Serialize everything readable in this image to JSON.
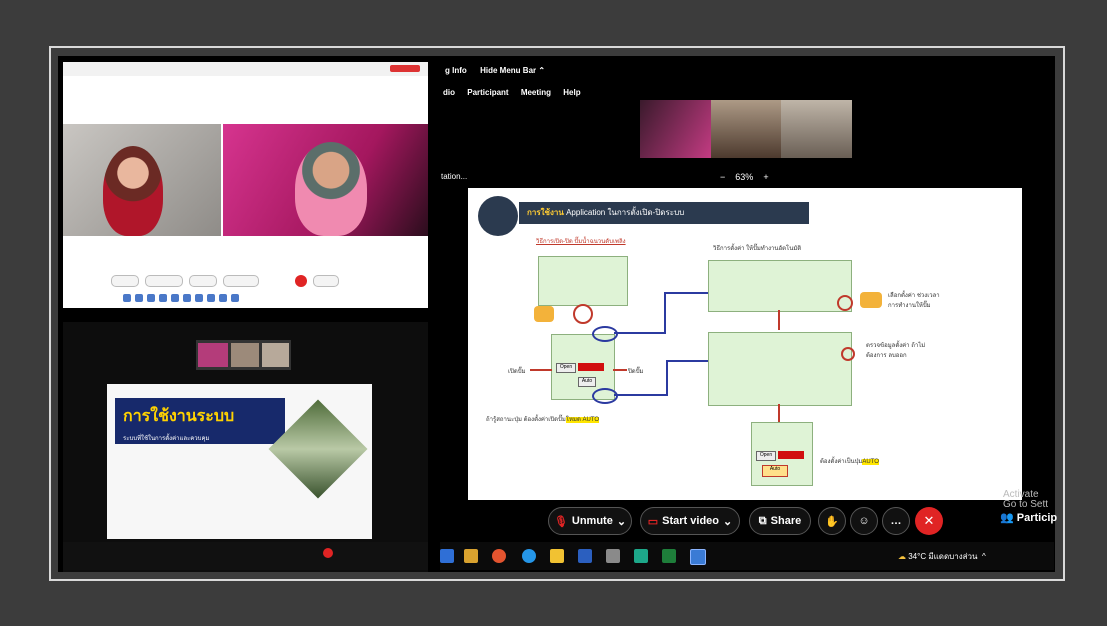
{
  "top_right_panel": {
    "menu_left": "g Info",
    "menu_hide": "Hide Menu Bar",
    "menu_items": [
      "dio",
      "Participant",
      "Meeting",
      "Help"
    ],
    "sharing_label": "tation...",
    "zoom_minus": "−",
    "zoom_value": "63%",
    "zoom_plus": "+"
  },
  "slide": {
    "header_bold": "การใช้งาน",
    "header_text": "Application ในการตั้งเปิด-ปิดระบบ",
    "step1_label": "วิธีการเปิด-ปิด ปั๊มน้ำฉนวนดับเพลิง",
    "step2_label": "วิธีการตั้งค่า ให้ปั๊มทำงานอัตโนมัติ",
    "left_open": "เปิดปั๊ม",
    "right_close": "ปิดปั๊ม",
    "open_btn": "Open",
    "close_btn": "Close",
    "auto_btn": "Auto",
    "note_bottom": "ถ้ารู้สถานะปุ่ม ต้องตั้งค่าเปิดปั๊ม",
    "note_auto": "โหมด AUTO",
    "right_note1": "เลือกตั้งค่า ช่วงเวลาการทำงานให้ปั๊ม",
    "right_note2": "ตรวจข้อมูลตั้งค่า ถ้าไม่ต้องการ ลบออก",
    "final_note": "ต้องตั้งค่าเป็นปุ่ม",
    "final_auto": "AUTO"
  },
  "bottom_left_slide": {
    "title": "การใช้งานระบบ",
    "subtitle": "ระบบที่ใช้ในการตั้งค่าและควบคุม"
  },
  "toolbar": {
    "unmute": "Unmute",
    "start_video": "Start video",
    "share": "Share",
    "participants": "Particip",
    "watermark_line1": "Activate",
    "watermark_line2": "Go to Sett"
  },
  "taskbar": {
    "weather": "34°C มีแดดบางส่วน"
  },
  "colors": {
    "end_call": "#e02424",
    "slide_header": "#2b3a4f",
    "highlight": "#ffe600",
    "video_pink": "#d6348f"
  }
}
